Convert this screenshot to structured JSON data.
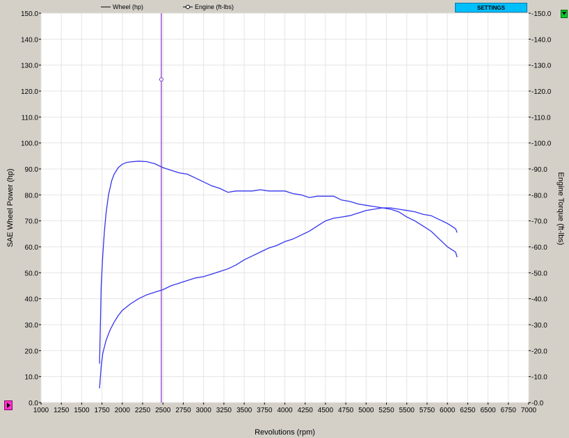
{
  "controls": {
    "settings_label": "SETTINGS",
    "collapse_button_icon": "triangle-down-icon",
    "marker_button_icon": "triangle-right-icon"
  },
  "colors": {
    "plot_background": "#ffffff",
    "window_background": "#d4d0c8",
    "curve": "#3333ee",
    "cursor_line": "#7a2fc9",
    "settings_button": "#00bfff"
  },
  "chart_data": {
    "type": "line",
    "xlabel": "Revolutions (rpm)",
    "ylabel_left": "SAE Wheel Power (hp)",
    "ylabel_right": "Engine Torque (ft-lbs)",
    "xlim": [
      1000,
      7000
    ],
    "ylim": [
      0,
      150
    ],
    "x_ticks": [
      "1000",
      "1250",
      "1500",
      "1750",
      "2000",
      "2250",
      "2500",
      "2750",
      "3000",
      "3250",
      "3500",
      "3750",
      "4000",
      "4250",
      "4500",
      "4750",
      "5000",
      "5250",
      "5500",
      "5750",
      "6000",
      "6250",
      "6500",
      "6750",
      "7000"
    ],
    "y_ticks_left": [
      "0.0",
      "10.0",
      "20.0",
      "30.0",
      "40.0",
      "50.0",
      "60.0",
      "70.0",
      "80.0",
      "90.0",
      "100.0",
      "110.0",
      "120.0",
      "130.0",
      "140.0",
      "150.0"
    ],
    "y_ticks_right": [
      "0.0",
      "10.0",
      "20.0",
      "30.0",
      "40.0",
      "50.0",
      "60.0",
      "70.0",
      "80.0",
      "90.0",
      "100.0",
      "110.0",
      "120.0",
      "130.0",
      "140.0",
      "150.0"
    ],
    "grid": true,
    "legend_position": "top-center",
    "legend": [
      {
        "label": "Wheel  (hp)",
        "marker": "line"
      },
      {
        "label": "Engine (ft-lbs)",
        "marker": "circle-line"
      }
    ],
    "cursor_rpm": 2480,
    "cursor_marker_value": 124.5,
    "series": [
      {
        "name": "Wheel  (hp)",
        "x": [
          1720,
          1740,
          1760,
          1800,
          1850,
          1900,
          1950,
          2000,
          2100,
          2200,
          2300,
          2400,
          2500,
          2600,
          2700,
          2800,
          2900,
          3000,
          3100,
          3200,
          3300,
          3400,
          3500,
          3600,
          3700,
          3800,
          3900,
          4000,
          4100,
          4200,
          4300,
          4400,
          4500,
          4600,
          4700,
          4800,
          4900,
          5000,
          5100,
          5200,
          5300,
          5400,
          5500,
          5600,
          5700,
          5800,
          5900,
          6000,
          6050,
          6100,
          6120
        ],
        "y": [
          5.5,
          14,
          19,
          24,
          28,
          31,
          33.5,
          35.5,
          38,
          40,
          41.5,
          42.5,
          43.5,
          45,
          46,
          47,
          48,
          48.5,
          49.5,
          50.5,
          51.5,
          53,
          55,
          56.5,
          58,
          59.5,
          60.5,
          62,
          63,
          64.5,
          66,
          68,
          70,
          71,
          71.5,
          72,
          73,
          74,
          74.5,
          75,
          74.5,
          73.5,
          71.5,
          70,
          68,
          66,
          63,
          60,
          59,
          58,
          56
        ]
      },
      {
        "name": "Engine (ft-lbs)",
        "x": [
          1720,
          1740,
          1760,
          1780,
          1800,
          1830,
          1870,
          1900,
          1950,
          2000,
          2050,
          2100,
          2200,
          2300,
          2400,
          2500,
          2600,
          2700,
          2800,
          2900,
          3000,
          3100,
          3200,
          3300,
          3400,
          3500,
          3600,
          3700,
          3800,
          3900,
          4000,
          4100,
          4200,
          4300,
          4400,
          4500,
          4600,
          4700,
          4800,
          4900,
          5000,
          5100,
          5200,
          5300,
          5400,
          5500,
          5600,
          5700,
          5800,
          5900,
          6000,
          6050,
          6100,
          6120
        ],
        "y": [
          15,
          45,
          57,
          66,
          73,
          80,
          85.5,
          88,
          90.5,
          91.8,
          92.5,
          92.7,
          93,
          92.8,
          92,
          90.5,
          89.5,
          88.5,
          88,
          86.5,
          85,
          83.5,
          82.5,
          81,
          81.5,
          81.5,
          81.5,
          82,
          81.5,
          81.5,
          81.5,
          80.5,
          80,
          79,
          79.5,
          79.5,
          79.5,
          78,
          77.5,
          76.5,
          76,
          75.5,
          75,
          75,
          74.5,
          74,
          73.5,
          72.5,
          72,
          70.5,
          69,
          68,
          67,
          65.5
        ]
      }
    ]
  }
}
